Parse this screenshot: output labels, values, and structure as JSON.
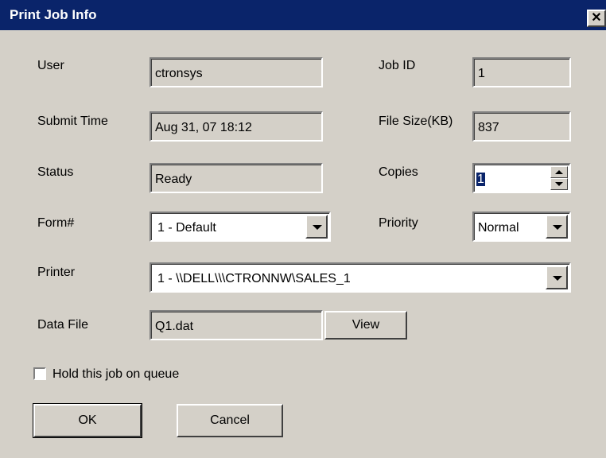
{
  "window": {
    "title": "Print Job Info",
    "close_icon": "close-icon",
    "colors": {
      "titlebar": "#0a246a",
      "face": "#d4d0c8"
    }
  },
  "fields": {
    "user": {
      "label": "User",
      "value": "ctronsys"
    },
    "job_id": {
      "label": "Job ID",
      "value": "1"
    },
    "submit_time": {
      "label": "Submit Time",
      "value": "Aug 31, 07  18:12"
    },
    "file_size": {
      "label": "File Size(KB)",
      "value": "837"
    },
    "status": {
      "label": "Status",
      "value": "Ready"
    },
    "copies": {
      "label": "Copies",
      "value": "1"
    },
    "form": {
      "label": "Form#",
      "value": "1 - Default"
    },
    "priority": {
      "label": "Priority",
      "value": "Normal"
    },
    "printer": {
      "label": "Printer",
      "value": "1 - \\\\DELL\\\\\\CTRONNW\\SALES_1"
    },
    "data_file": {
      "label": "Data File",
      "value": "Q1.dat"
    }
  },
  "buttons": {
    "view": "View",
    "ok": "OK",
    "cancel": "Cancel"
  },
  "hold_checkbox": {
    "label": "Hold this job on queue",
    "checked": false
  }
}
